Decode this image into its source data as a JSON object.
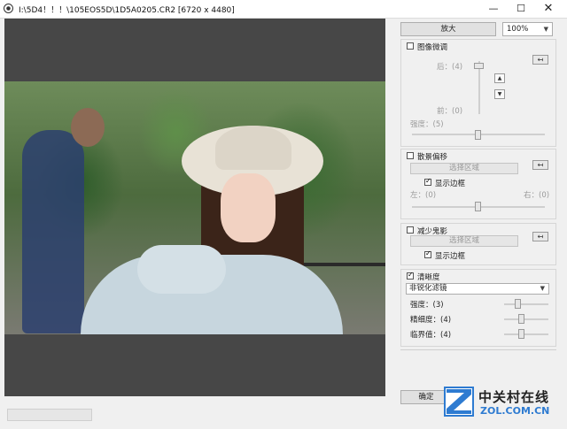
{
  "window": {
    "title": "I:\\5D4！！！\\105EOS5D\\1D5A0205.CR2 [6720 x 4480]",
    "controls": {
      "minimize": "—",
      "maximize": "☐",
      "close": "✕"
    }
  },
  "toolbar": {
    "zoom_button": "放大",
    "zoom_level": "100%"
  },
  "image_adjust": {
    "label": "图像微调",
    "checked": false,
    "back_label": "后：(4)",
    "front_label": "前：(0)",
    "strength_label": "强度：(5)"
  },
  "background_shift": {
    "label": "散景偏移",
    "checked": false,
    "select_area": "选择区域",
    "show_border": "显示边框",
    "show_border_checked": true,
    "left_label": "左：(0)",
    "right_label": "右：(0)"
  },
  "ghost_reduction": {
    "label": "减少鬼影",
    "checked": false,
    "select_area": "选择区域",
    "show_border": "显示边框",
    "show_border_checked": true
  },
  "sharpness": {
    "label": "清晰度",
    "checked": true,
    "filter": "非锐化滤镜",
    "strength_label": "强度：(3)",
    "fineness_label": "精细度：(4)",
    "threshold_label": "临界值：(4)"
  },
  "footer": {
    "ok_button": "确定"
  },
  "watermark": {
    "cn": "中关村在线",
    "en": "ZOL.COM.CN"
  },
  "colors": {
    "preview_bg": "#474747",
    "panel_bg": "#f0f0f0",
    "logo_blue": "#2e7bd1"
  }
}
